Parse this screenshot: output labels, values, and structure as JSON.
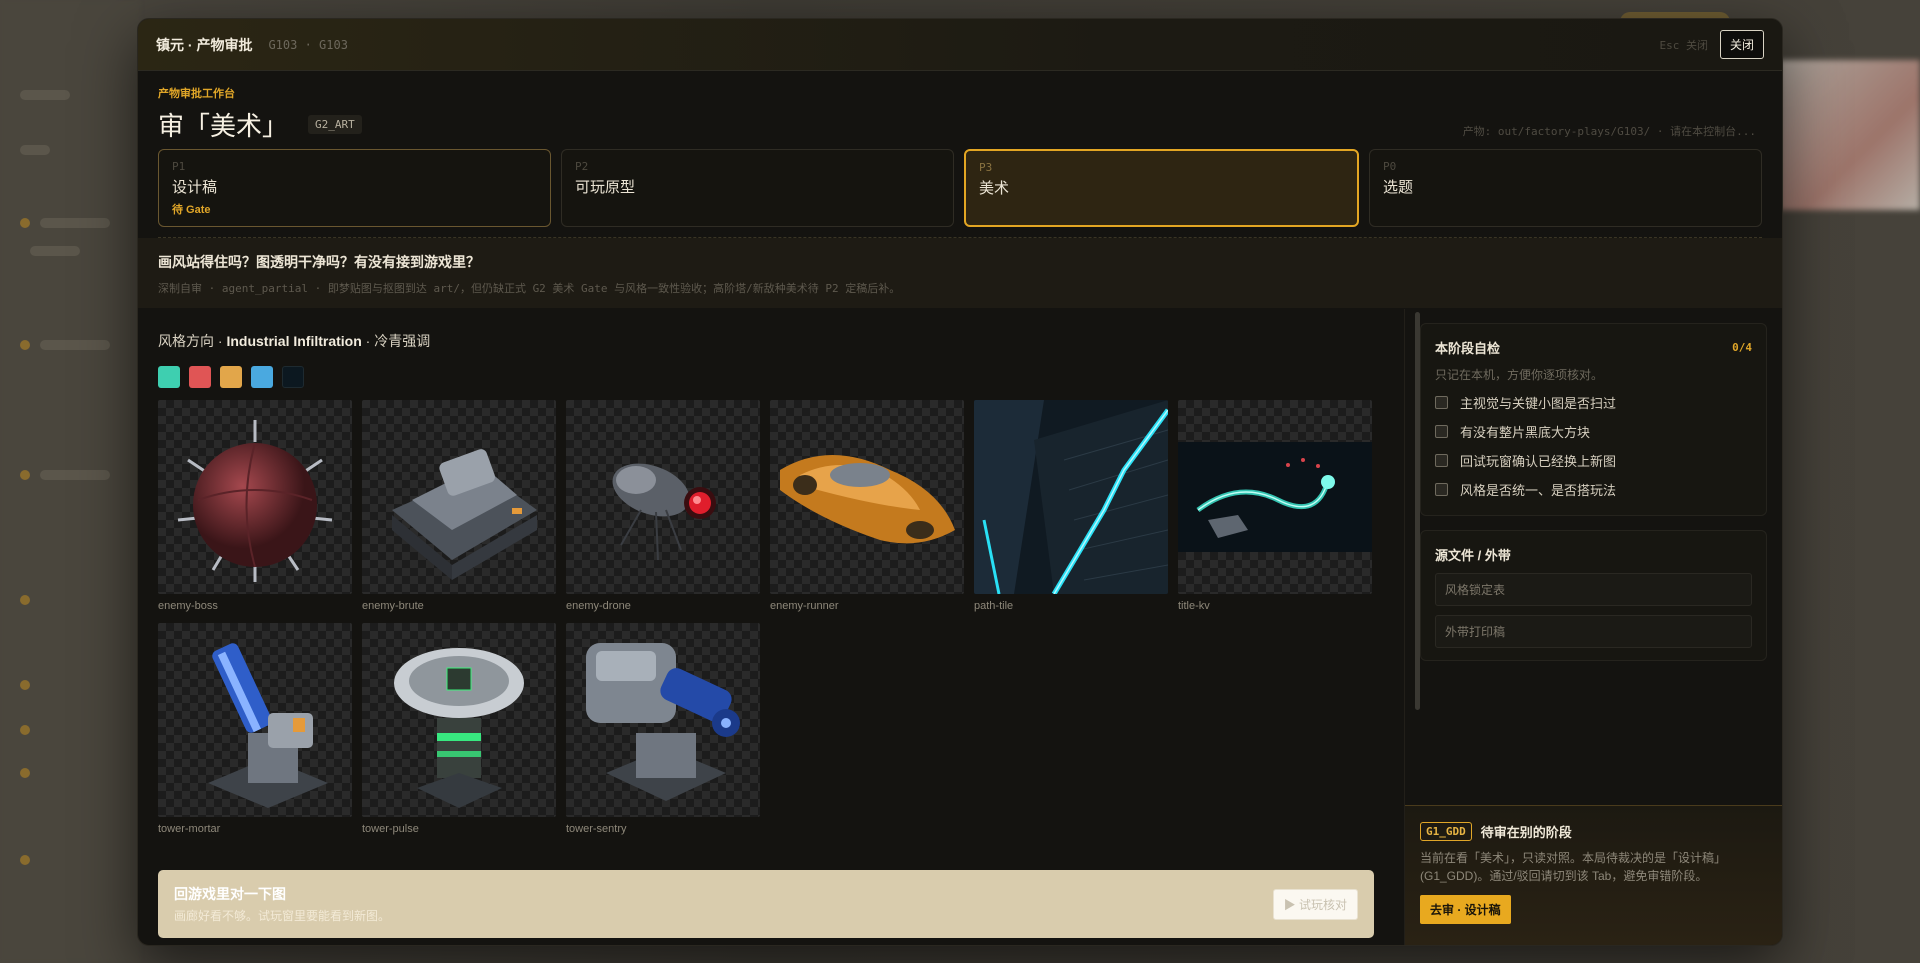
{
  "modal": {
    "title": "镇元 · 产物审批",
    "subtitle": "G103 · G103",
    "esc_hint": "Esc 关闭",
    "close_label": "关闭"
  },
  "workbench": {
    "eyebrow": "产物审批工作台",
    "title": "审「美术」",
    "tag": "G2_ART",
    "product_path": "产物: out/factory-plays/G103/ · 请在本控制台..."
  },
  "stages": [
    {
      "code": "P1",
      "name": "设计稿",
      "gate": "待 Gate"
    },
    {
      "code": "P2",
      "name": "可玩原型",
      "gate": ""
    },
    {
      "code": "P3",
      "name": "美术",
      "gate": ""
    },
    {
      "code": "P0",
      "name": "选题",
      "gate": ""
    }
  ],
  "question": {
    "title": "画风站得住吗？图透明干净吗？有没有接到游戏里？",
    "note": "深制自审 · agent_partial · 即梦贴图与抠图到达 art/，但仍缺正式 G2 美术 Gate 与风格一致性验收；高阶塔/新敌种美术待 P2 定稿后补。"
  },
  "style": {
    "prefix": "风格方向 · ",
    "name": "Industrial Infiltration",
    "suffix": " · 冷青强调",
    "swatches": [
      "#3ecfb0",
      "#e05555",
      "#e2a64a",
      "#4aa9e0",
      "#0c1820"
    ]
  },
  "assets": [
    {
      "name": "enemy-boss",
      "icon": "spiked-sphere-icon"
    },
    {
      "name": "enemy-brute",
      "icon": "tank-icon"
    },
    {
      "name": "enemy-drone",
      "icon": "drone-icon"
    },
    {
      "name": "enemy-runner",
      "icon": "hovercar-icon"
    },
    {
      "name": "path-tile",
      "icon": "neon-path-tile-icon"
    },
    {
      "name": "title-kv",
      "icon": "key-visual-icon"
    },
    {
      "name": "tower-mortar",
      "icon": "mortar-tower-icon"
    },
    {
      "name": "tower-pulse",
      "icon": "pulse-tower-icon"
    },
    {
      "name": "tower-sentry",
      "icon": "gatling-tower-icon"
    }
  ],
  "cta": {
    "title": "回游戏里对一下图",
    "subtitle": "画廊好看不够。试玩窗里要能看到新图。",
    "button": "▶ 试玩核对"
  },
  "checklist": {
    "title": "本阶段自检",
    "count": "0/4",
    "hint": "只记在本机，方便你逐项核对。",
    "items": [
      "主视觉与关键小图是否扫过",
      "有没有整片黑底大方块",
      "回试玩窗确认已经换上新图",
      "风格是否统一、是否搭玩法"
    ]
  },
  "sources": {
    "title": "源文件 / 外带",
    "items": [
      "风格锁定表",
      "外带打印稿"
    ]
  },
  "pending": {
    "tag": "G1_GDD",
    "title": "待审在别的阶段",
    "desc": "当前在看「美术」，只读对照。本局待裁决的是「设计稿」(G1_GDD)。通过/驳回请切到该 Tab，避免审错阶段。",
    "button": "去审 · 设计稿"
  }
}
